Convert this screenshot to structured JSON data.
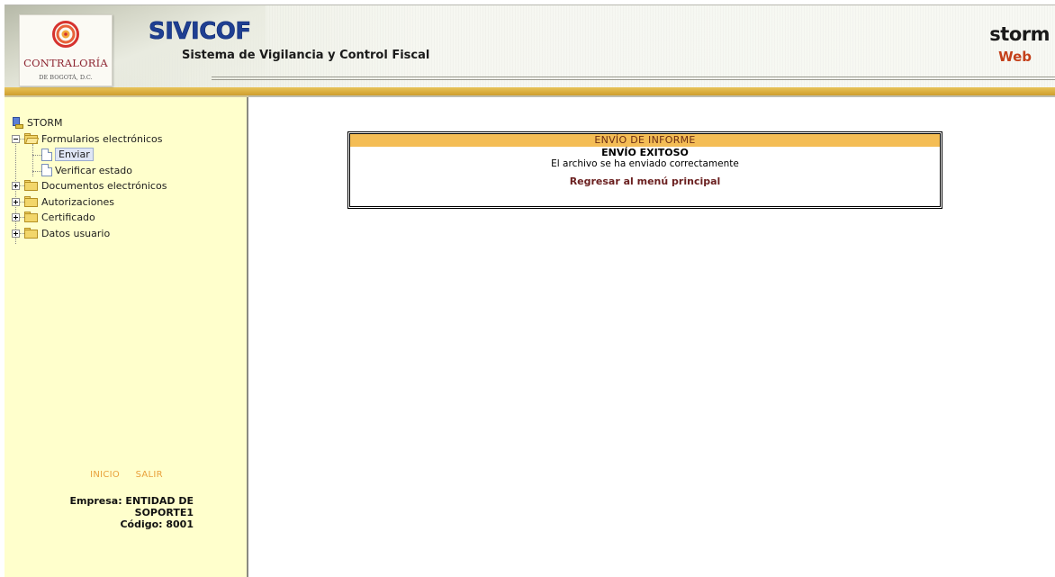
{
  "header": {
    "logo_name": "CONTRALORÍA",
    "logo_sub": "DE BOGOTÁ, D.C.",
    "app_title": "SIVICOF",
    "app_subtitle": "Sistema de Vigilancia y Control Fiscal",
    "brand_word": "storm",
    "brand_sub": "Web"
  },
  "sidebar": {
    "root_label": "STORM",
    "tree": [
      {
        "label": "Formularios electrónicos",
        "expanded": true,
        "children": [
          {
            "label": "Enviar",
            "selected": true
          },
          {
            "label": "Verificar estado",
            "selected": false
          }
        ]
      },
      {
        "label": "Documentos electrónicos",
        "expanded": false
      },
      {
        "label": "Autorizaciones",
        "expanded": false
      },
      {
        "label": "Certificado",
        "expanded": false
      },
      {
        "label": "Datos usuario",
        "expanded": false
      }
    ],
    "links": {
      "home": "INICIO",
      "logout": "SALIR"
    },
    "company_line1": "Empresa: ENTIDAD DE",
    "company_line2": "SOPORTE1",
    "code_line": "Código: 8001"
  },
  "main": {
    "box_title": "ENVÍO DE INFORME",
    "status": "ENVÍO EXITOSO",
    "message": "El archivo se ha enviado correctamente",
    "back_link": "Regresar al menú principal"
  },
  "colors": {
    "sidebar_bg": "#ffffcc",
    "header_stripe": "#d9ad3d",
    "box_title_bg": "#f4bd55",
    "link_color": "#6a1f1f",
    "side_link_color": "#e8a03a"
  }
}
